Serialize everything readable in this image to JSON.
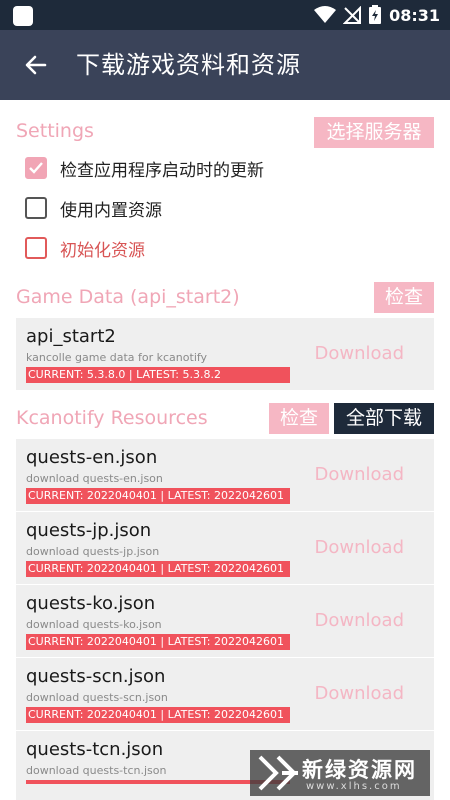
{
  "statusbar": {
    "time": "08:31"
  },
  "header": {
    "title": "下载游戏资料和资源"
  },
  "settings": {
    "title": "Settings",
    "server_button": "选择服务器",
    "options": [
      {
        "label": "检查应用程序启动时的更新",
        "checked": true
      },
      {
        "label": "使用内置资源",
        "checked": false
      },
      {
        "label": "初始化资源",
        "checked": false
      }
    ]
  },
  "game_data": {
    "title": "Game Data (api_start2)",
    "check_button": "检查",
    "item": {
      "name": "api_start2",
      "desc": "kancolle game data for kcanotify",
      "version": "CURRENT: 5.3.8.0 | LATEST: 5.3.8.2",
      "action": "Download"
    }
  },
  "resources": {
    "title": "Kcanotify Resources",
    "check_button": "检查",
    "download_all_button": "全部下载",
    "items": [
      {
        "name": "quests-en.json",
        "desc": "download quests-en.json",
        "version": "CURRENT: 2022040401 | LATEST: 2022042601",
        "action": "Download"
      },
      {
        "name": "quests-jp.json",
        "desc": "download quests-jp.json",
        "version": "CURRENT: 2022040401 | LATEST: 2022042601",
        "action": "Download"
      },
      {
        "name": "quests-ko.json",
        "desc": "download quests-ko.json",
        "version": "CURRENT: 2022040401 | LATEST: 2022042601",
        "action": "Download"
      },
      {
        "name": "quests-scn.json",
        "desc": "download quests-scn.json",
        "version": "CURRENT: 2022040401 | LATEST: 2022042601",
        "action": "Download"
      },
      {
        "name": "quests-tcn.json",
        "desc": "download quests-tcn.json",
        "version": "",
        "action": ""
      }
    ]
  },
  "watermark": {
    "text": "新绿资源网",
    "url": "www.xlhs.com"
  }
}
